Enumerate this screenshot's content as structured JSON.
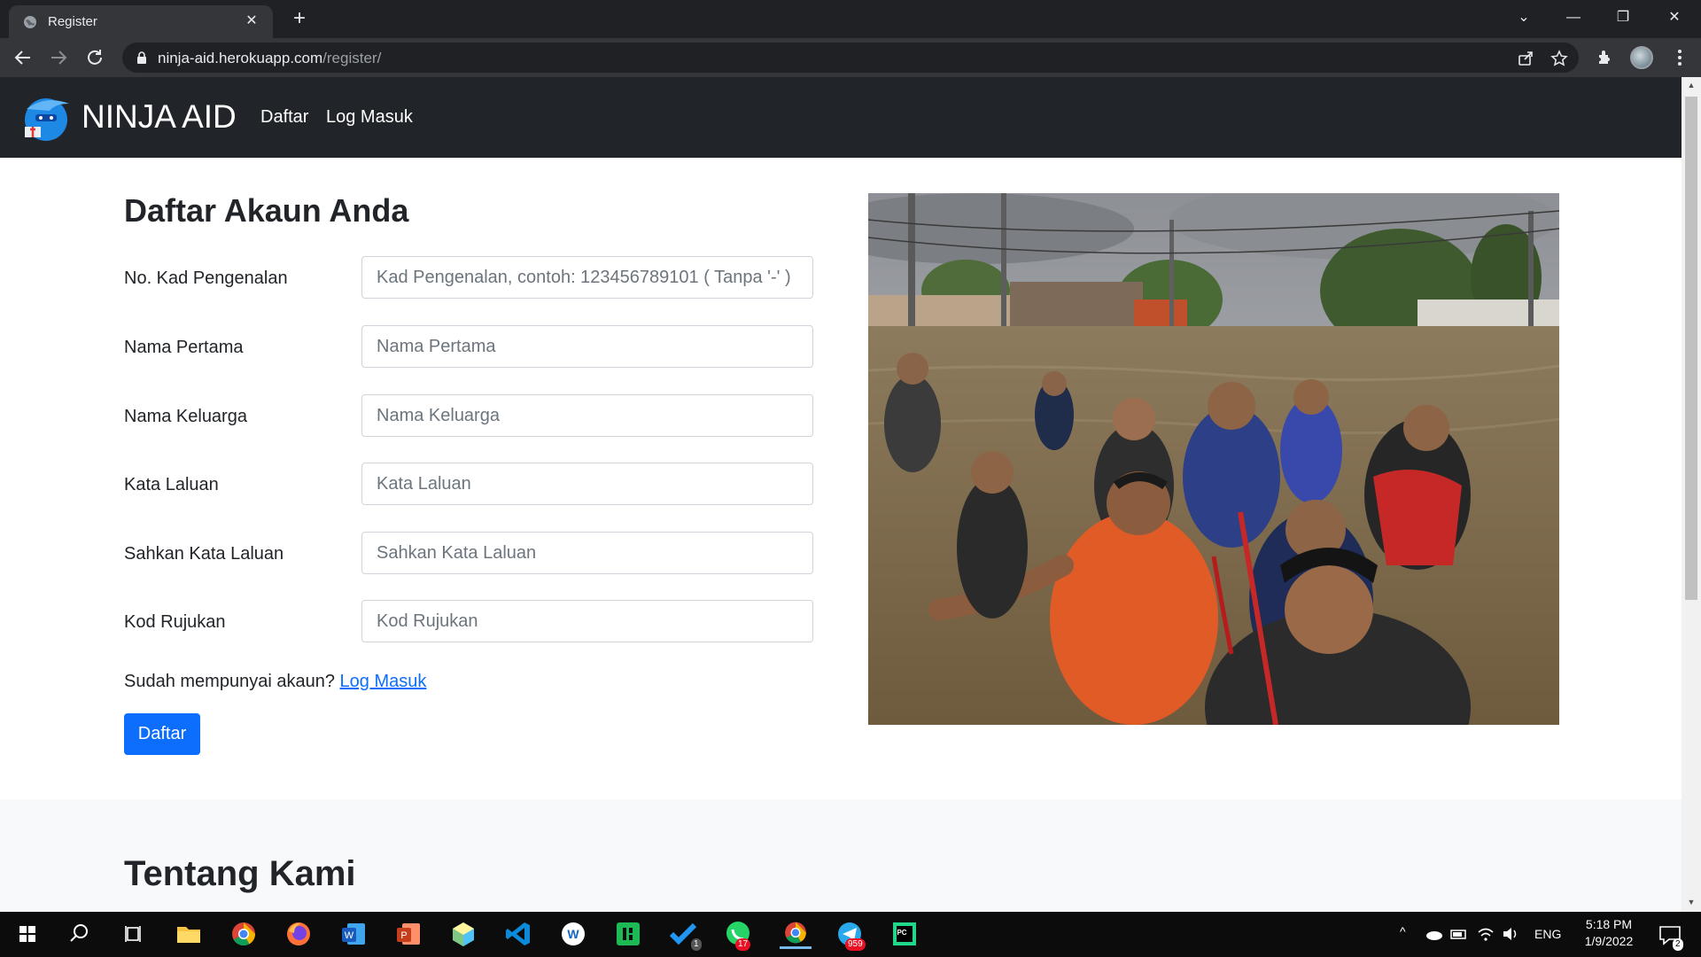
{
  "browser": {
    "tab_title": "Register",
    "url_domain": "ninja-aid.herokuapp.com",
    "url_path": "/register/"
  },
  "site": {
    "brand": "NINJA AID",
    "nav": [
      {
        "label": "Daftar"
      },
      {
        "label": "Log Masuk"
      }
    ]
  },
  "register": {
    "title": "Daftar Akaun Anda",
    "fields": [
      {
        "label": "No. Kad Pengenalan",
        "placeholder": "Kad Pengenalan, contoh: 123456789101 ( Tanpa '-' )",
        "value": ""
      },
      {
        "label": "Nama Pertama",
        "placeholder": "Nama Pertama",
        "value": ""
      },
      {
        "label": "Nama Keluarga",
        "placeholder": "Nama Keluarga",
        "value": ""
      },
      {
        "label": "Kata Laluan",
        "placeholder": "Kata Laluan",
        "value": ""
      },
      {
        "label": "Sahkan Kata Laluan",
        "placeholder": "Sahkan Kata Laluan",
        "value": ""
      },
      {
        "label": "Kod Rujukan",
        "placeholder": "Kod Rujukan",
        "value": ""
      }
    ],
    "signin_prompt": "Sudah mempunyai akaun?",
    "signin_link": "Log Masuk",
    "submit_label": "Daftar"
  },
  "about": {
    "title": "Tentang Kami"
  },
  "taskbar": {
    "apps": [
      "file-explorer",
      "chrome",
      "firefox",
      "word",
      "powerpoint",
      "app-cube",
      "vscode",
      "app-w",
      "app-green",
      "todo",
      "whatsapp",
      "chrome-active",
      "telegram",
      "pycharm"
    ],
    "badges": {
      "todo": "1",
      "whatsapp": "17",
      "telegram": "959"
    },
    "language": "ENG",
    "time": "5:18 PM",
    "date": "1/9/2022",
    "notifications": "2"
  },
  "colors": {
    "navbar": "#212529",
    "primary": "#0d6efd",
    "chrome_dark": "#202124"
  }
}
